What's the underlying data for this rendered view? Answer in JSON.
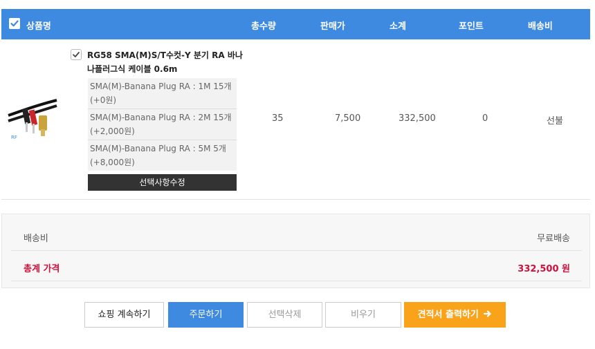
{
  "header": {
    "product": "상품명",
    "quantity": "총수량",
    "price": "판매가",
    "subtotal": "소계",
    "points": "포인트",
    "shipping": "배송비"
  },
  "product": {
    "name": "RG58 SMA(M)S/T수컷-Y 분기 RA 바나나플러그식 케이블 0.6m",
    "options": [
      "SMA(M)-Banana Plug RA : 1M 15개 (+0원)",
      "SMA(M)-Banana Plug RA : 2M 15개 (+2,000원)",
      "SMA(M)-Banana Plug RA : 5M 5개 (+8,000원)"
    ],
    "edit_label": "선택사항수정",
    "quantity": "35",
    "price": "7,500",
    "subtotal": "332,500",
    "points": "0",
    "shipping": "선불"
  },
  "summary": {
    "shipping_label": "배송비",
    "shipping_value": "무료배송",
    "total_label": "총계 가격",
    "total_value": "332,500 원"
  },
  "buttons": {
    "continue": "쇼핑 계속하기",
    "order": "주문하기",
    "delete": "선택삭제",
    "empty": "비우기",
    "quote": "견적서 출력하기"
  },
  "colors": {
    "header_bg": "#3d8ae0",
    "total_red": "#d0103a",
    "quote_orange": "#f9a31b"
  }
}
